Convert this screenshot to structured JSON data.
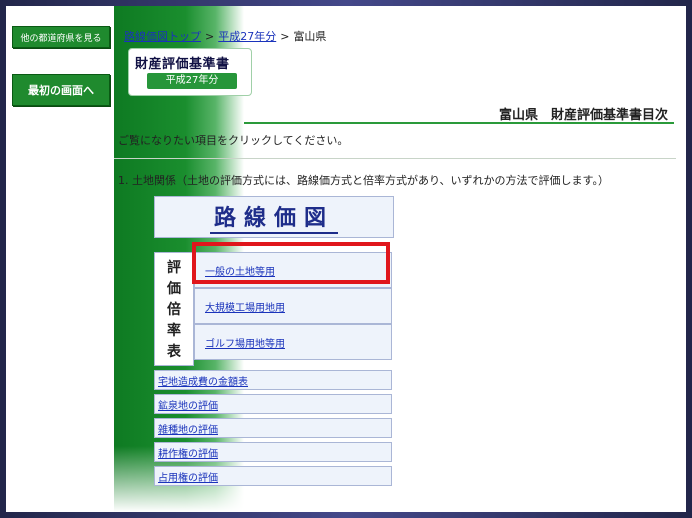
{
  "left_nav": {
    "other_prefectures_label": "他の都道府県を見る",
    "first_page_label": "最初の画面へ"
  },
  "breadcrumb": {
    "top_link": "路線価図トップ",
    "year_link": "平成27年分",
    "current": "富山県",
    "separator": ">"
  },
  "logo": {
    "title": "財産評価基準書",
    "subtitle": "平成27年分"
  },
  "page_heading": "富山県　財産評価基準書目次",
  "instruction": "ご覧になりたい項目をクリックしてください。",
  "section_1": "1. 土地関係（土地の評価方式には、路線価方式と倍率方式があり、いずれかの方法で評価します。）",
  "rosenka_label": "路線価図",
  "bairitsu": {
    "chars": [
      "評",
      "価",
      "倍",
      "率",
      "表"
    ],
    "items": [
      "一般の土地等用",
      "大規模工場用地用",
      "ゴルフ場用地等用"
    ]
  },
  "links": [
    "宅地造成費の金額表",
    "鉱泉地の評価",
    "雑種地の評価",
    "耕作権の評価",
    "占用権の評価"
  ],
  "colors": {
    "accent_green": "#1f8a2e",
    "highlight_red": "#e0161c",
    "link_blue": "#1a33bb"
  }
}
